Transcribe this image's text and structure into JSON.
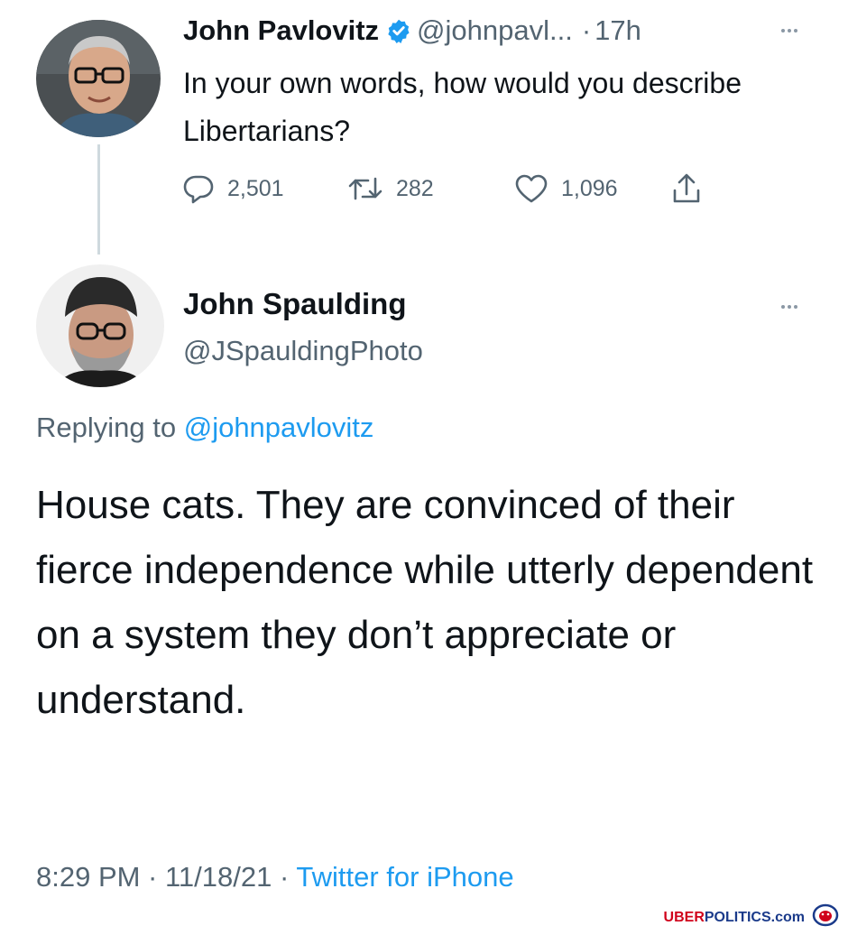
{
  "tweet_1": {
    "author_name": "John Pavlovitz",
    "handle": "@johnpavl...",
    "separator": "·",
    "time": "17h",
    "text": "In your own words, how would you describe Libertarians?",
    "stats": {
      "replies": "2,501",
      "retweets": "282",
      "likes": "1,096"
    },
    "icons": {
      "verified": "verified-badge-icon",
      "more": "more-options-icon",
      "reply": "reply-bubble-icon",
      "retweet": "retweet-icon",
      "like": "heart-icon",
      "share": "share-icon"
    }
  },
  "tweet_2": {
    "author_name": "John Spaulding",
    "handle": "@JSpauldingPhoto",
    "replying_prefix": "Replying to",
    "replying_to": "@johnpavlovitz",
    "text": "House cats. They are convinced of their fierce independence while utterly dependent on a system they don’t appreciate or understand.",
    "timestamp": "8:29 PM · 11/18/21 ·",
    "source": "Twitter for iPhone"
  },
  "colors": {
    "text_primary": "#0f1419",
    "text_secondary": "#536471",
    "link_blue": "#1d9bf0",
    "verified_blue": "#1d9bf0",
    "thread_line": "#cfd9de"
  },
  "watermark": {
    "part_1": "UBER",
    "part_2": "POLITICS.com"
  }
}
